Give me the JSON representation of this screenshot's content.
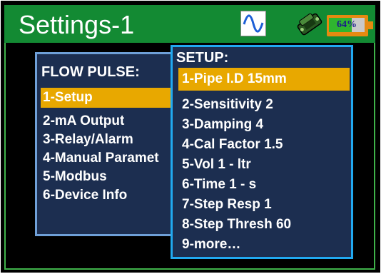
{
  "header": {
    "title": "Settings-1",
    "wave_icon": "sine-wave-icon",
    "meter_icon": "flow-meter-icon",
    "battery": {
      "label": "64%",
      "level": 0.64
    }
  },
  "main_menu": {
    "title": "FLOW PULSE:",
    "items": [
      {
        "label": "1-Setup",
        "selected": true
      },
      {
        "label": "2-mA Output"
      },
      {
        "label": "3-Relay/Alarm"
      },
      {
        "label": "4-Manual Paramet"
      },
      {
        "label": "5-Modbus"
      },
      {
        "label": "6-Device Info"
      }
    ]
  },
  "setup_menu": {
    "title": "SETUP:",
    "items": [
      {
        "label": "1-Pipe I.D  15mm",
        "selected": true
      },
      {
        "label": "2-Sensitivity  2"
      },
      {
        "label": "3-Damping  4"
      },
      {
        "label": "4-Cal Factor  1.5"
      },
      {
        "label": "5-Vol 1 - ltr"
      },
      {
        "label": "6-Time 1 - s"
      },
      {
        "label": "7-Step Resp  1"
      },
      {
        "label": "8-Step Thresh  60"
      },
      {
        "label": "9-more…"
      }
    ]
  },
  "colors": {
    "header_bg": "#138a33",
    "highlight": "#e8a800",
    "panel_bg": "#1c2e50",
    "setup_border": "#21a9f0"
  }
}
